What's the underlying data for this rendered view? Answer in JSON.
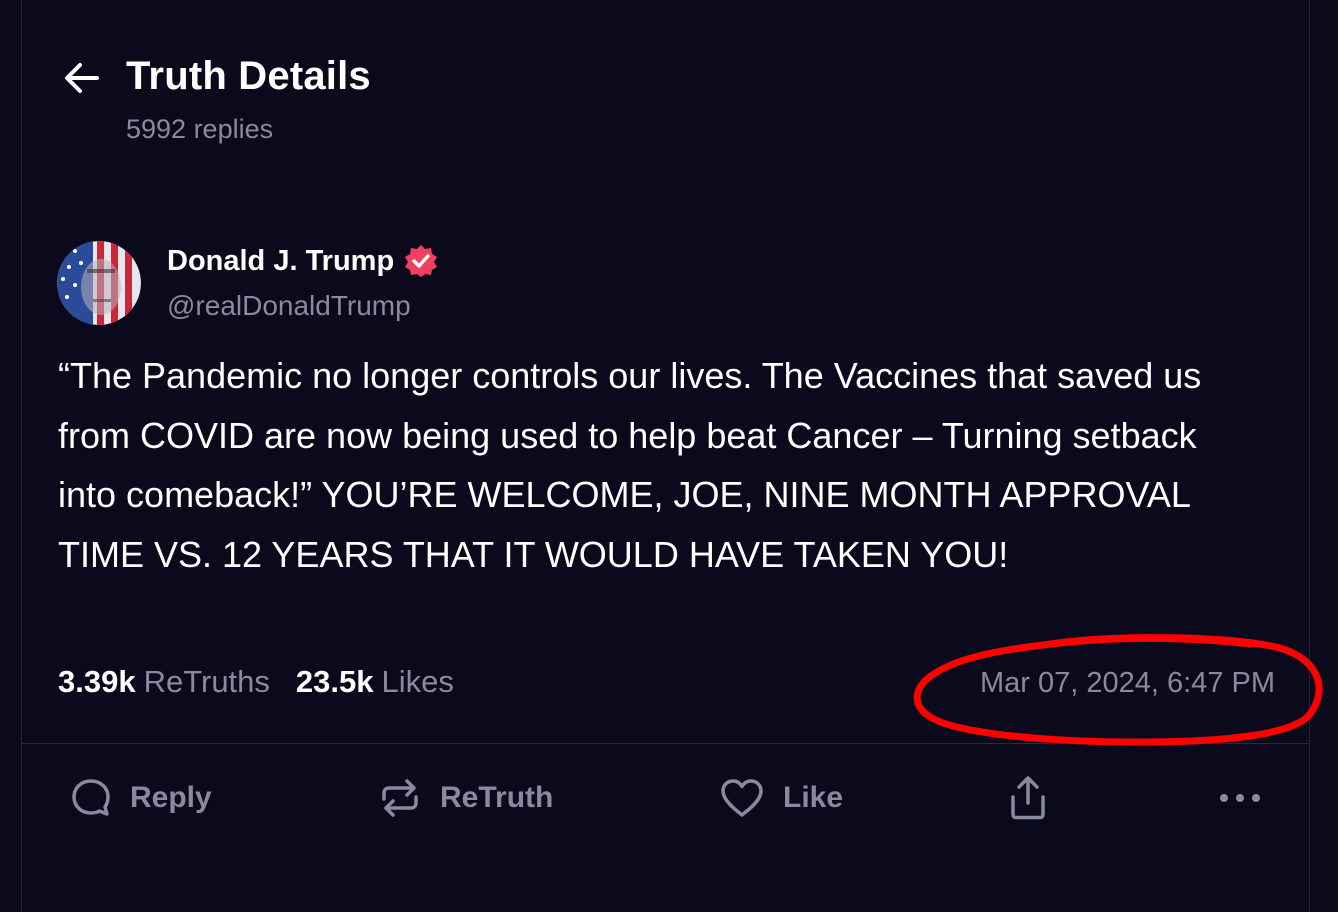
{
  "header": {
    "title": "Truth Details",
    "replies": "5992 replies",
    "back_icon": "arrow-left-icon"
  },
  "post": {
    "author_name": "Donald J. Trump",
    "author_handle": "@realDonaldTrump",
    "verified_icon": "verified-badge-icon",
    "verified_color": "#f0405f",
    "text": "“The Pandemic no longer controls our lives. The Vaccines that saved us from COVID are now being used to help beat Cancer – Turning setback into comeback!” YOU’RE WELCOME, JOE, NINE MONTH APPROVAL TIME VS. 12 YEARS THAT IT WOULD HAVE TAKEN YOU!",
    "retruths_count": "3.39k",
    "retruths_label": "ReTruths",
    "likes_count": "23.5k",
    "likes_label": "Likes",
    "timestamp": "Mar 07, 2024, 6:47 PM"
  },
  "annotation": {
    "type": "hand-drawn circle around timestamp",
    "color": "#ff0000"
  },
  "actions": {
    "reply_label": "Reply",
    "reply_icon": "comment-icon",
    "retruth_label": "ReTruth",
    "retruth_icon": "repost-icon",
    "like_label": "Like",
    "like_icon": "heart-icon",
    "share_icon": "share-icon",
    "more_icon": "more-horizontal-icon"
  },
  "colors": {
    "background": "#0b0a1c",
    "muted_text": "#8a8a9e",
    "primary_text": "#ffffff"
  }
}
